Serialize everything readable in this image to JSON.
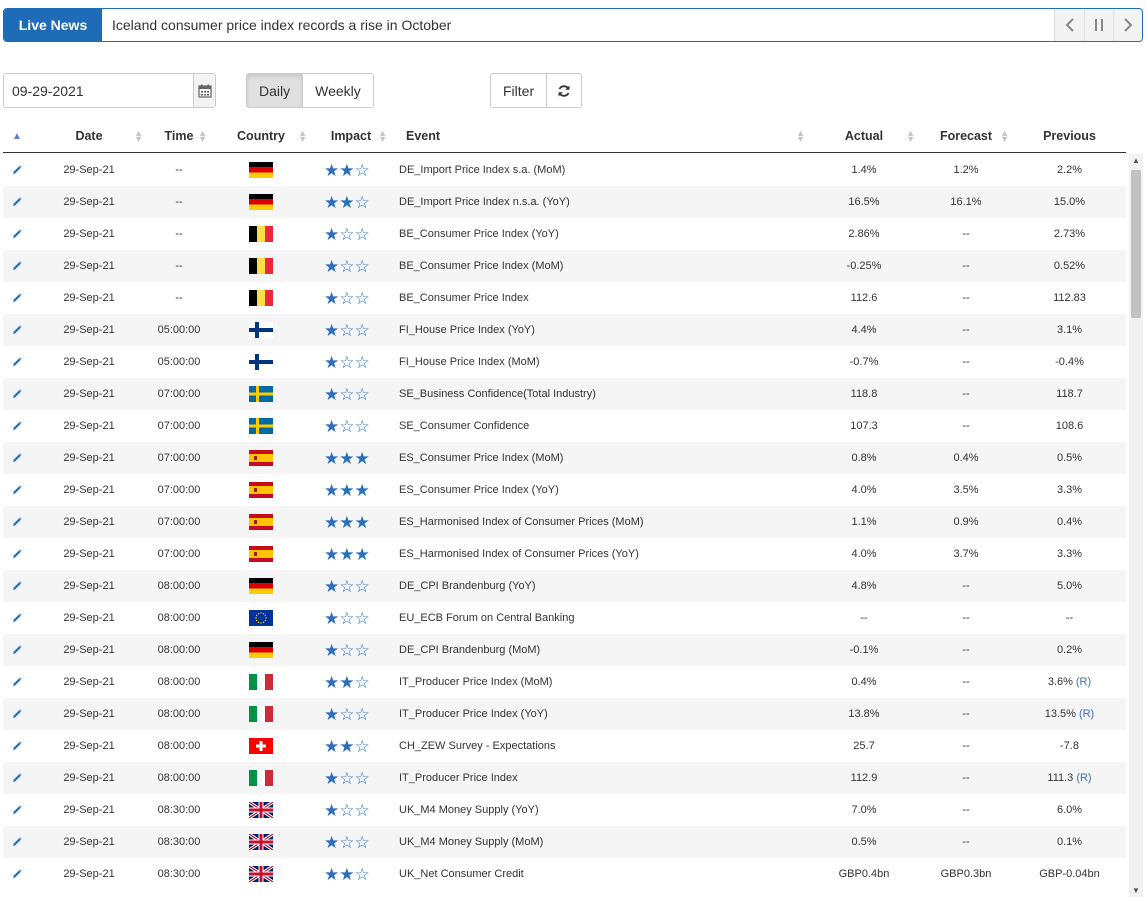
{
  "ticker": {
    "label": "Live News",
    "headline": "Iceland consumer price index records a rise in October",
    "prev_icon": "chevron-left-icon",
    "pause_icon": "pause-icon",
    "next_icon": "chevron-right-icon"
  },
  "toolbar": {
    "date_value": "09-29-2021",
    "calendar_icon": "calendar-icon",
    "daily_label": "Daily",
    "weekly_label": "Weekly",
    "active_view": "Daily",
    "filter_label": "Filter",
    "refresh_icon": "refresh-icon"
  },
  "table": {
    "columns": [
      "",
      "Date",
      "Time",
      "Country",
      "Impact",
      "Event",
      "Actual",
      "Forecast",
      "Previous"
    ],
    "rows": [
      {
        "date": "29-Sep-21",
        "time": "--",
        "country": "DE",
        "impact": 2,
        "event": "DE_Import Price Index s.a. (MoM)",
        "actual": "1.4%",
        "forecast": "1.2%",
        "previous": "2.2%",
        "revised": ""
      },
      {
        "date": "29-Sep-21",
        "time": "--",
        "country": "DE",
        "impact": 2,
        "event": "DE_Import Price Index n.s.a. (YoY)",
        "actual": "16.5%",
        "forecast": "16.1%",
        "previous": "15.0%",
        "revised": ""
      },
      {
        "date": "29-Sep-21",
        "time": "--",
        "country": "BE",
        "impact": 1,
        "event": "BE_Consumer Price Index (YoY)",
        "actual": "2.86%",
        "forecast": "--",
        "previous": "2.73%",
        "revised": ""
      },
      {
        "date": "29-Sep-21",
        "time": "--",
        "country": "BE",
        "impact": 1,
        "event": "BE_Consumer Price Index (MoM)",
        "actual": "-0.25%",
        "forecast": "--",
        "previous": "0.52%",
        "revised": ""
      },
      {
        "date": "29-Sep-21",
        "time": "--",
        "country": "BE",
        "impact": 1,
        "event": "BE_Consumer Price Index",
        "actual": "112.6",
        "forecast": "--",
        "previous": "112.83",
        "revised": ""
      },
      {
        "date": "29-Sep-21",
        "time": "05:00:00",
        "country": "FI",
        "impact": 1,
        "event": "FI_House Price Index (YoY)",
        "actual": "4.4%",
        "forecast": "--",
        "previous": "3.1%",
        "revised": ""
      },
      {
        "date": "29-Sep-21",
        "time": "05:00:00",
        "country": "FI",
        "impact": 1,
        "event": "FI_House Price Index (MoM)",
        "actual": "-0.7%",
        "forecast": "--",
        "previous": "-0.4%",
        "revised": ""
      },
      {
        "date": "29-Sep-21",
        "time": "07:00:00",
        "country": "SE",
        "impact": 1,
        "event": "SE_Business Confidence(Total Industry)",
        "actual": "118.8",
        "forecast": "--",
        "previous": "118.7",
        "revised": ""
      },
      {
        "date": "29-Sep-21",
        "time": "07:00:00",
        "country": "SE",
        "impact": 1,
        "event": "SE_Consumer Confidence",
        "actual": "107.3",
        "forecast": "--",
        "previous": "108.6",
        "revised": ""
      },
      {
        "date": "29-Sep-21",
        "time": "07:00:00",
        "country": "ES",
        "impact": 3,
        "event": "ES_Consumer Price Index (MoM)",
        "actual": "0.8%",
        "forecast": "0.4%",
        "previous": "0.5%",
        "revised": ""
      },
      {
        "date": "29-Sep-21",
        "time": "07:00:00",
        "country": "ES",
        "impact": 3,
        "event": "ES_Consumer Price Index (YoY)",
        "actual": "4.0%",
        "forecast": "3.5%",
        "previous": "3.3%",
        "revised": ""
      },
      {
        "date": "29-Sep-21",
        "time": "07:00:00",
        "country": "ES",
        "impact": 3,
        "event": "ES_Harmonised Index of Consumer Prices (MoM)",
        "actual": "1.1%",
        "forecast": "0.9%",
        "previous": "0.4%",
        "revised": ""
      },
      {
        "date": "29-Sep-21",
        "time": "07:00:00",
        "country": "ES",
        "impact": 3,
        "event": "ES_Harmonised Index of Consumer Prices (YoY)",
        "actual": "4.0%",
        "forecast": "3.7%",
        "previous": "3.3%",
        "revised": ""
      },
      {
        "date": "29-Sep-21",
        "time": "08:00:00",
        "country": "DE",
        "impact": 1,
        "event": "DE_CPI Brandenburg (YoY)",
        "actual": "4.8%",
        "forecast": "--",
        "previous": "5.0%",
        "revised": ""
      },
      {
        "date": "29-Sep-21",
        "time": "08:00:00",
        "country": "EU",
        "impact": 1,
        "event": "EU_ECB Forum on Central Banking",
        "actual": "--",
        "forecast": "--",
        "previous": "--",
        "revised": ""
      },
      {
        "date": "29-Sep-21",
        "time": "08:00:00",
        "country": "DE",
        "impact": 1,
        "event": "DE_CPI Brandenburg (MoM)",
        "actual": "-0.1%",
        "forecast": "--",
        "previous": "0.2%",
        "revised": ""
      },
      {
        "date": "29-Sep-21",
        "time": "08:00:00",
        "country": "IT",
        "impact": 2,
        "event": "IT_Producer Price Index (MoM)",
        "actual": "0.4%",
        "forecast": "--",
        "previous": "3.6%",
        "revised": "(R)"
      },
      {
        "date": "29-Sep-21",
        "time": "08:00:00",
        "country": "IT",
        "impact": 1,
        "event": "IT_Producer Price Index (YoY)",
        "actual": "13.8%",
        "forecast": "--",
        "previous": "13.5%",
        "revised": "(R)"
      },
      {
        "date": "29-Sep-21",
        "time": "08:00:00",
        "country": "CH",
        "impact": 2,
        "event": "CH_ZEW Survey - Expectations",
        "actual": "25.7",
        "forecast": "--",
        "previous": "-7.8",
        "revised": ""
      },
      {
        "date": "29-Sep-21",
        "time": "08:00:00",
        "country": "IT",
        "impact": 1,
        "event": "IT_Producer Price Index",
        "actual": "112.9",
        "forecast": "--",
        "previous": "111.3",
        "revised": "(R)"
      },
      {
        "date": "29-Sep-21",
        "time": "08:30:00",
        "country": "UK",
        "impact": 1,
        "event": "UK_M4 Money Supply (YoY)",
        "actual": "7.0%",
        "forecast": "--",
        "previous": "6.0%",
        "revised": ""
      },
      {
        "date": "29-Sep-21",
        "time": "08:30:00",
        "country": "UK",
        "impact": 1,
        "event": "UK_M4 Money Supply (MoM)",
        "actual": "0.5%",
        "forecast": "--",
        "previous": "0.1%",
        "revised": ""
      },
      {
        "date": "29-Sep-21",
        "time": "08:30:00",
        "country": "UK",
        "impact": 2,
        "event": "UK_Net Consumer Credit",
        "actual": "GBP0.4bn",
        "forecast": "GBP0.3bn",
        "previous": "GBP-0.04bn",
        "revised": ""
      }
    ]
  },
  "colors": {
    "accent": "#1e6bb8",
    "star": "#2a6fc1",
    "revised": "#3a6fb5"
  }
}
